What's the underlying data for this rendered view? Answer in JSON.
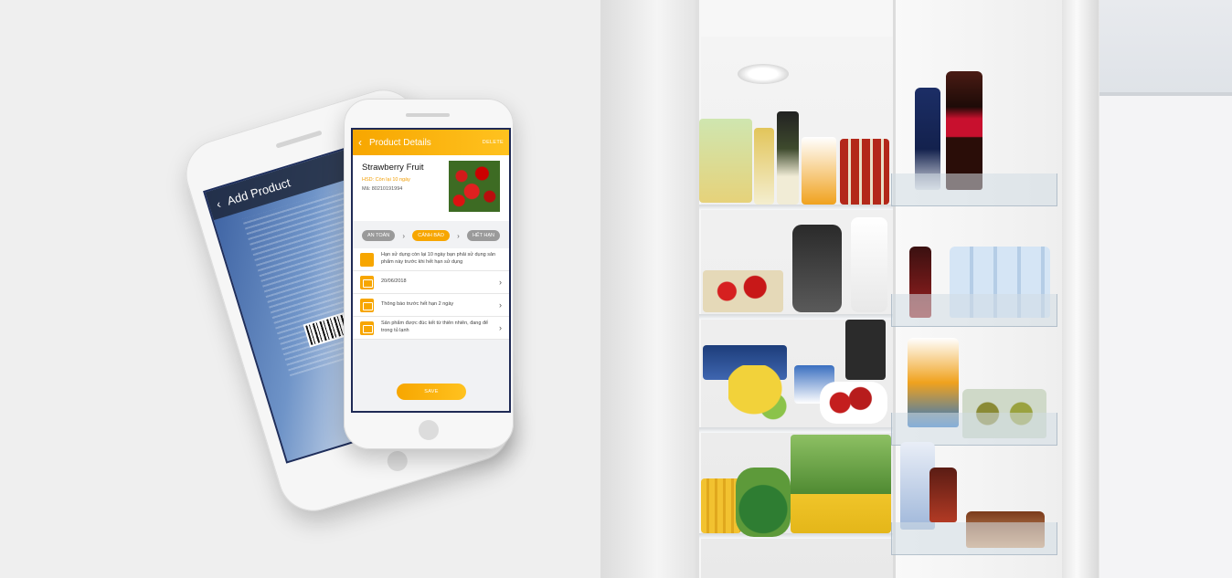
{
  "back_phone": {
    "title": "Add Product"
  },
  "front_phone": {
    "appbar": {
      "back_glyph": "‹",
      "title": "Product Details",
      "delete_label": "DELETE"
    },
    "product": {
      "name": "Strawberry Fruit",
      "hsd": "HSD: Còn lại 10 ngày",
      "code": "Mã: 80210191994"
    },
    "steps": [
      {
        "label": "AN TOÀN",
        "active": false
      },
      {
        "label": "CẢNH BÁO",
        "active": true
      },
      {
        "label": "HẾT HẠN",
        "active": false
      }
    ],
    "rows": [
      {
        "text": "Hạn sử dụng còn lại 10 ngày bạn phải sử dụng sản phẩm này trước khi hết hạn sử dụng",
        "arrow": false
      },
      {
        "text": "20/06/2018",
        "arrow": true
      },
      {
        "text": "Thông báo trước hết hạn 2 ngày",
        "arrow": true
      },
      {
        "text": "Sản phẩm được đúc kết từ thiên nhiên, đang để trong tủ lạnh",
        "arrow": true
      }
    ],
    "save_label": "SAVE"
  },
  "colors": {
    "accent": "#f7a600",
    "accent_light": "#ffc21f",
    "screen_border": "#1f2a55"
  }
}
